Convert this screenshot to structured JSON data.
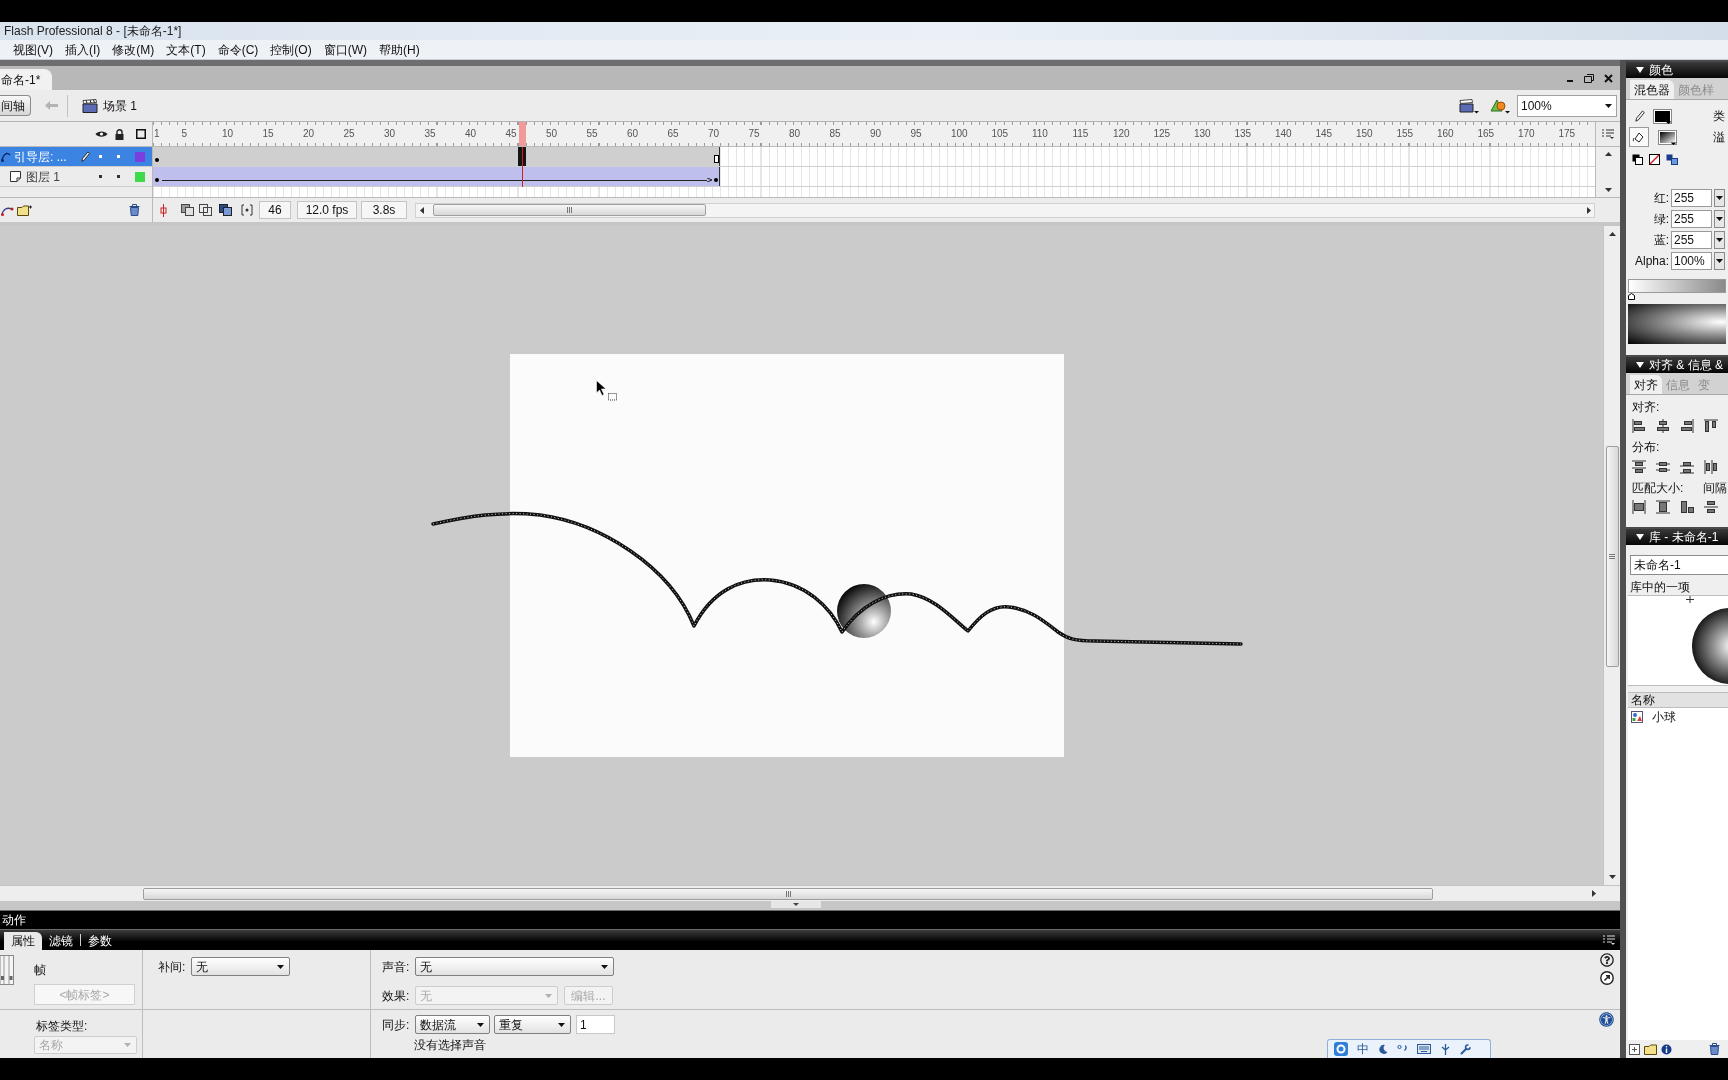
{
  "window": {
    "title": "Flash Professional 8 - [未命名-1*]"
  },
  "menu": [
    "视图(V)",
    "插入(I)",
    "修改(M)",
    "文本(T)",
    "命令(C)",
    "控制(O)",
    "窗口(W)",
    "帮助(H)"
  ],
  "document": {
    "tab": "命名-1*"
  },
  "edit_bar": {
    "timeline_button": "间轴",
    "scene": "场景 1",
    "zoom": "100%"
  },
  "timeline": {
    "ruler": [
      "1",
      "5",
      "10",
      "15",
      "20",
      "25",
      "30",
      "35",
      "40",
      "45",
      "50",
      "55",
      "60",
      "65",
      "70",
      "75",
      "80",
      "85",
      "90",
      "95",
      "100",
      "105",
      "110",
      "115",
      "120",
      "125",
      "130",
      "135",
      "140",
      "145",
      "150",
      "155",
      "160",
      "165",
      "170",
      "175"
    ],
    "playhead": {
      "level": 0.2528
    },
    "layers": [
      {
        "name": "引导层: ...",
        "kind": "guide",
        "selected": true,
        "color": "#7b3fe0",
        "level": 0.3932
      },
      {
        "name": "图层 1",
        "kind": "tween",
        "selected": false,
        "color": "#3fd94c",
        "level": 0.3932
      }
    ],
    "status": {
      "frame": "46",
      "fps": "12.0 fps",
      "time": "3.8s"
    }
  },
  "actions_panel": {
    "title": "动作"
  },
  "properties": {
    "tabs": [
      {
        "label": "属性",
        "selected": true
      },
      {
        "label": "滤镜",
        "selected": false
      },
      {
        "label": "参数",
        "selected": false
      }
    ],
    "frame": {
      "title": "帧",
      "label_placeholder": "<帧标签>",
      "label_type_label": "标签类型:",
      "label_type": {
        "value": "名称",
        "disabled": true
      }
    },
    "tween": {
      "label": "补间:",
      "value": "无"
    },
    "sound": {
      "label": "声音:",
      "value": "无"
    },
    "effect": {
      "label": "效果:",
      "value": "无",
      "disabled": true,
      "edit_button": "编辑...",
      "edit_disabled": true
    },
    "sync": {
      "label": "同步:",
      "mode": "数据流",
      "repeat": "重复",
      "count": "1"
    },
    "note": "没有选择声音"
  },
  "ime_bar": {
    "mode": "中"
  },
  "color_panel": {
    "title": "颜色",
    "tabs": [
      {
        "label": "混色器",
        "selected": true
      },
      {
        "label": "颜色样",
        "selected": false
      }
    ],
    "type_label": "类",
    "overflow_label": "溢",
    "channels": [
      {
        "label": "红:",
        "value": "255"
      },
      {
        "label": "绿:",
        "value": "255"
      },
      {
        "label": "蓝:",
        "value": "255"
      },
      {
        "label": "Alpha:",
        "value": "100%"
      }
    ]
  },
  "align_panel": {
    "title": "对齐 & 信息 &",
    "tabs": [
      {
        "label": "对齐",
        "selected": true
      },
      {
        "label": "信息",
        "selected": false
      },
      {
        "label": "变",
        "selected": false
      }
    ],
    "align_label": "对齐:",
    "distribute_label": "分布:",
    "match_label": "匹配大小:",
    "spacing_label": "间隔"
  },
  "library_panel": {
    "title": "库 - 未命名-1",
    "document": "未命名-1",
    "preview_label": "库中的一项",
    "column": "名称",
    "items": [
      {
        "name": "小球"
      }
    ]
  }
}
